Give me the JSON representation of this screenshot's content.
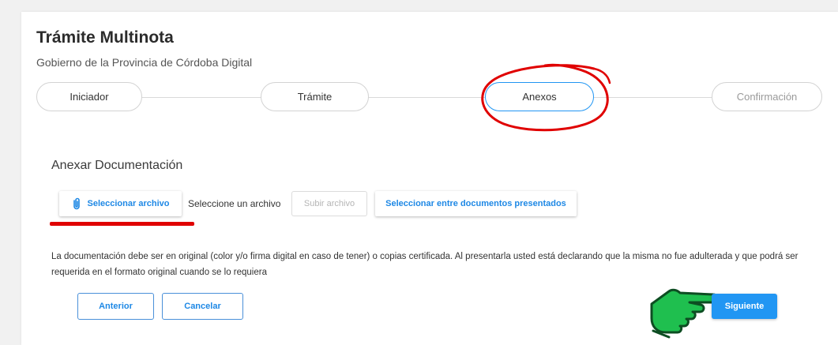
{
  "header": {
    "title": "Trámite Multinota",
    "subtitle": "Gobierno de la Provincia de Córdoba Digital"
  },
  "stepper": {
    "steps": [
      {
        "label": "Iniciador",
        "state": "completed"
      },
      {
        "label": "Trámite",
        "state": "completed"
      },
      {
        "label": "Anexos",
        "state": "active"
      },
      {
        "label": "Confirmación",
        "state": "disabled"
      }
    ]
  },
  "attachments": {
    "section_title": "Anexar Documentación",
    "select_file_label": "Seleccionar archivo",
    "file_status": "Seleccione un archivo",
    "upload_label": "Subir archivo",
    "select_presented_label": "Seleccionar entre documentos presentados",
    "disclaimer": "La documentación debe ser en original (color y/o firma digital en caso de tener) o copias certificada. Al presentarla usted está declarando que la misma no fue adulterada y que podrá ser requerida en el formato original cuando se lo requiera"
  },
  "actions": {
    "back_label": "Anterior",
    "cancel_label": "Cancelar",
    "next_label": "Siguiente"
  },
  "icons": {
    "attach": "paperclip-icon",
    "pointer": "pointing-hand-icon"
  },
  "colors": {
    "accent": "#2196f3",
    "annotation": "#e00000",
    "hand": "#1fbf4f"
  }
}
